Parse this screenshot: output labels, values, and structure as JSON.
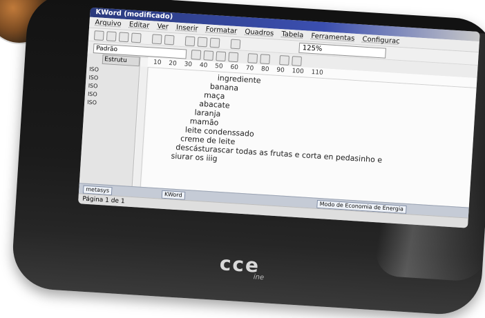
{
  "app": {
    "title": "KWord (modificado)"
  },
  "menu": [
    "Arquivo",
    "Editar",
    "Ver",
    "Inserir",
    "Formatar",
    "Quadros",
    "Tabela",
    "Ferramentas",
    "Configurac"
  ],
  "toolbar": {
    "zoom_value": "125%"
  },
  "format_bar": {
    "style": "Padrão"
  },
  "ruler": [
    "10",
    "20",
    "30",
    "40",
    "50",
    "60",
    "70",
    "80",
    "90",
    "100",
    "110"
  ],
  "side_panel": {
    "tab_label": "Estrutu",
    "items": [
      "ISO",
      "ISO",
      "ISO",
      "ISO",
      "ISO"
    ]
  },
  "document_lines": [
    "ingrediente",
    "banana",
    "maça",
    "abacate",
    "laranja",
    "mamão",
    "leite condenssado",
    "creme de leite",
    "descásturascar todas as frutas e corta en pedasinho e",
    "siurar os iiig"
  ],
  "status_bar": {
    "page": "Página 1 de 1"
  },
  "taskbar": {
    "start": "metasys",
    "window": "KWord",
    "notice": "Modo de Economia de Energia"
  },
  "device": {
    "brand": "cce",
    "model": "ine"
  }
}
